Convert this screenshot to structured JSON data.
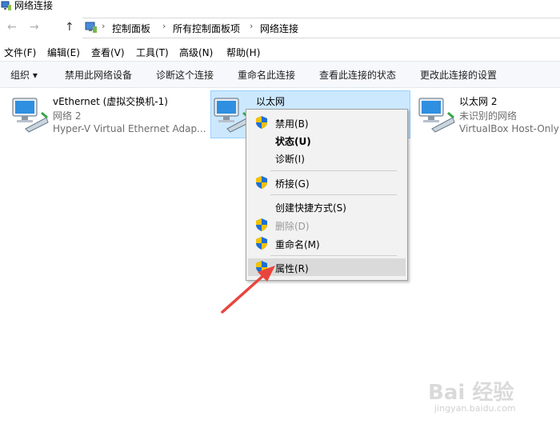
{
  "window": {
    "title": "网络连接",
    "icon": "network-connections-icon"
  },
  "address": {
    "back_icon": "back-arrow-icon",
    "forward_icon": "forward-arrow-icon",
    "up_icon": "up-arrow-icon",
    "crumbs": [
      "控制面板",
      "所有控制面板项",
      "网络连接"
    ]
  },
  "menubar": [
    "文件(F)",
    "编辑(E)",
    "查看(V)",
    "工具(T)",
    "高级(N)",
    "帮助(H)"
  ],
  "toolbar": {
    "organize": "组织 ▾",
    "items": [
      "禁用此网络设备",
      "诊断这个连接",
      "重命名此连接",
      "查看此连接的状态",
      "更改此连接的设置"
    ]
  },
  "connections": [
    {
      "name": "vEthernet (虚拟交换机-1)",
      "status": "网络  2",
      "device": "Hyper-V Virtual Ethernet Adap...",
      "icon": "network-adapter-icon"
    },
    {
      "name": "以太网",
      "status": "",
      "device": "",
      "icon": "network-adapter-icon",
      "selected": true
    },
    {
      "name": "以太网 2",
      "status": "未识别的网络",
      "device": "VirtualBox Host-Only",
      "icon": "network-adapter-icon"
    }
  ],
  "context_menu": [
    {
      "label": "禁用(B)",
      "shield": true
    },
    {
      "label": "状态(U)",
      "bold": true
    },
    {
      "label": "诊断(I)"
    },
    {
      "label": "桥接(G)",
      "shield": true
    },
    {
      "label": "创建快捷方式(S)"
    },
    {
      "label": "删除(D)",
      "shield": true,
      "disabled": true
    },
    {
      "label": "重命名(M)",
      "shield": true
    },
    {
      "label": "属性(R)",
      "shield": true,
      "highlighted": true
    }
  ],
  "colors": {
    "selection": "#cce8ff",
    "arrow": "#e8453c",
    "shield_blue": "#1f6fd1",
    "shield_yellow": "#f2c200"
  },
  "watermark": {
    "logo": "Bai 经验",
    "url": "jingyan.baidu.com"
  }
}
